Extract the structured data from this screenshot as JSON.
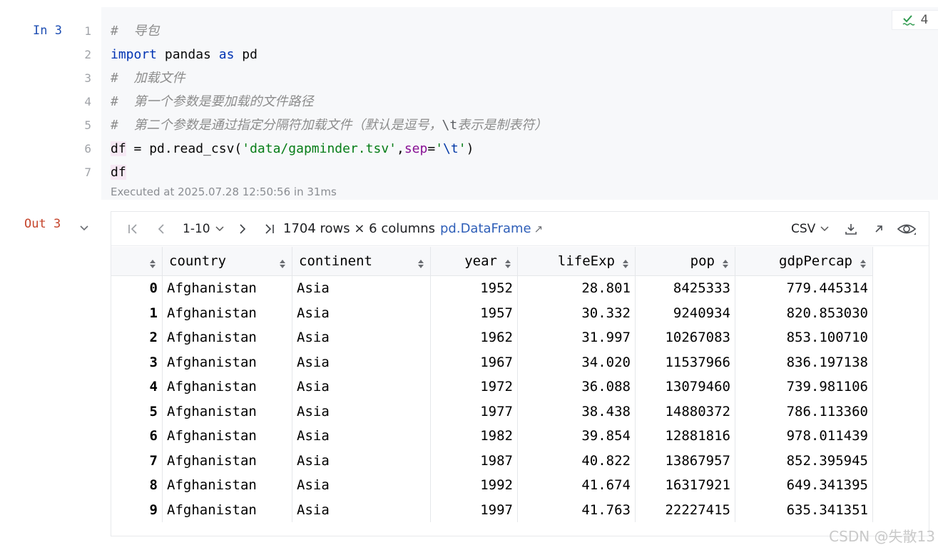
{
  "input_cell": {
    "prompt": "In 3",
    "badge_count": "4",
    "line_numbers": [
      "1",
      "2",
      "3",
      "4",
      "5",
      "6",
      "7"
    ],
    "code": {
      "l1_comment": "#  导包",
      "l2_kw_import": "import",
      "l2_module": " pandas ",
      "l2_kw_as": "as",
      "l2_alias": " pd",
      "l3_comment": "#  加载文件",
      "l4_comment": "#  第一个参数是要加载的文件路径",
      "l5_comment_a": "#  第二个参数是通过指定分隔符加载文件（默认是逗号，",
      "l5_escape": "\\t",
      "l5_comment_b": "表示是制表符）",
      "l6_var": "df",
      "l6_assign": " = pd.read_csv(",
      "l6_path": "'data/gapminder.tsv'",
      "l6_comma": ",",
      "l6_param": "sep",
      "l6_eq": "=",
      "l6_q1": "'",
      "l6_esc": "\\t",
      "l6_q2": "'",
      "l6_close": ")",
      "l7_var": "df"
    },
    "executed_meta": "Executed at 2025.07.28 12:50:56 in 31ms"
  },
  "output_cell": {
    "prompt": "Out 3",
    "toolbar": {
      "page_range": "1-10",
      "rows_info": "1704 rows × 6 columns",
      "type_link": "pd.DataFrame",
      "type_link_arrow": "↗",
      "export_format": "CSV"
    },
    "table": {
      "columns": [
        "country",
        "continent",
        "year",
        "lifeExp",
        "pop",
        "gdpPercap"
      ],
      "rows": [
        [
          "0",
          "Afghanistan",
          "Asia",
          "1952",
          "28.801",
          "8425333",
          "779.445314"
        ],
        [
          "1",
          "Afghanistan",
          "Asia",
          "1957",
          "30.332",
          "9240934",
          "820.853030"
        ],
        [
          "2",
          "Afghanistan",
          "Asia",
          "1962",
          "31.997",
          "10267083",
          "853.100710"
        ],
        [
          "3",
          "Afghanistan",
          "Asia",
          "1967",
          "34.020",
          "11537966",
          "836.197138"
        ],
        [
          "4",
          "Afghanistan",
          "Asia",
          "1972",
          "36.088",
          "13079460",
          "739.981106"
        ],
        [
          "5",
          "Afghanistan",
          "Asia",
          "1977",
          "38.438",
          "14880372",
          "786.113360"
        ],
        [
          "6",
          "Afghanistan",
          "Asia",
          "1982",
          "39.854",
          "12881816",
          "978.011439"
        ],
        [
          "7",
          "Afghanistan",
          "Asia",
          "1987",
          "40.822",
          "13867957",
          "852.395945"
        ],
        [
          "8",
          "Afghanistan",
          "Asia",
          "1992",
          "41.674",
          "16317921",
          "649.341395"
        ],
        [
          "9",
          "Afghanistan",
          "Asia",
          "1997",
          "41.763",
          "22227415",
          "635.341351"
        ]
      ]
    }
  },
  "watermark": "CSDN @失散13",
  "colors": {
    "keyword": "#0033b3",
    "string": "#067d17",
    "comment": "#8c8c8c",
    "param": "#871094",
    "in_prompt": "#1f4fb3",
    "out_prompt": "#c5442b",
    "link": "#2f5fb8"
  }
}
